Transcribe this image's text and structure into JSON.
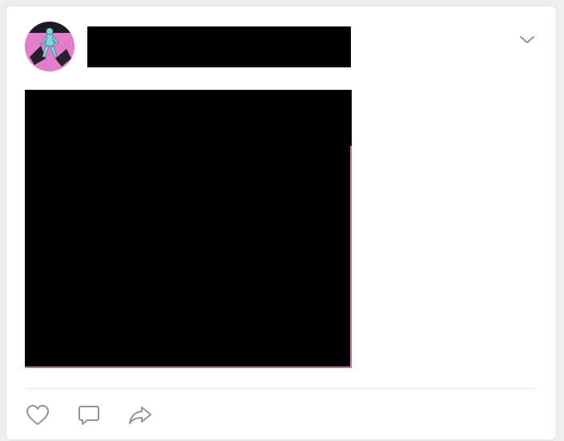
{
  "post": {
    "author": {
      "avatar_description": "avatar-image",
      "name_redacted": true
    },
    "image_redacted": true,
    "menu_icon": "chevron-down-icon"
  },
  "actions": {
    "like_icon": "heart-icon",
    "comment_icon": "comment-icon",
    "share_icon": "share-icon"
  },
  "colors": {
    "page_background": "#edeef0",
    "card_background": "#ffffff",
    "icon_gray": "#939699",
    "redaction": "#000000",
    "avatar_pink": "#e37fc9",
    "image_edge_pink": "#c06aa9",
    "divider": "#e3e4e8"
  }
}
